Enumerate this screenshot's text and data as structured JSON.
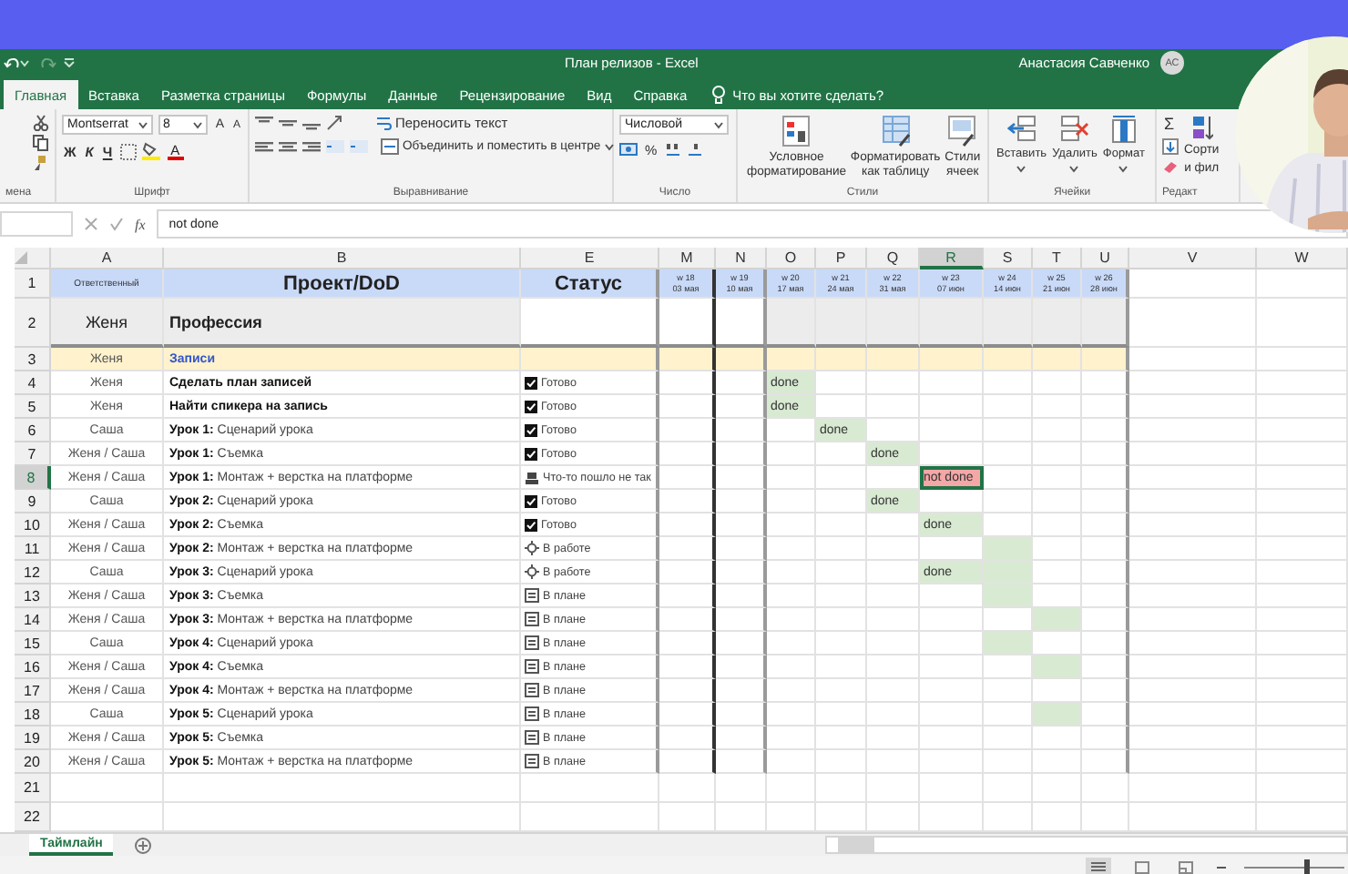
{
  "window": {
    "title": "План релизов - Excel",
    "user": "Анастасия Савченко",
    "avatar": "АС"
  },
  "ribbon_tabs": [
    {
      "label": "Главная",
      "selected": true
    },
    {
      "label": "Вставка",
      "selected": false
    },
    {
      "label": "Разметка страницы",
      "selected": false
    },
    {
      "label": "Формулы",
      "selected": false
    },
    {
      "label": "Данные",
      "selected": false
    },
    {
      "label": "Рецензирование",
      "selected": false
    },
    {
      "label": "Вид",
      "selected": false
    },
    {
      "label": "Справка",
      "selected": false
    }
  ],
  "tell_me": "Что вы хотите сделать?",
  "ribbon": {
    "clipboard": {
      "label": "мена"
    },
    "font": {
      "name": "Montserrat",
      "size": "8",
      "grow": "A",
      "shrink": "A",
      "bold": "Ж",
      "italic": "К",
      "underline": "Ч",
      "font_color_button": "A",
      "label": "Шрифт"
    },
    "alignment": {
      "wrap": "Переносить текст",
      "merge": "Объединить и поместить в центре",
      "label": "Выравнивание"
    },
    "number": {
      "format": "Числовой",
      "percent": "%",
      "label": "Число"
    },
    "styles": {
      "buttons": [
        "Условное форматирование",
        "Форматировать как таблицу",
        "Стили ячеек"
      ],
      "label": "Стили"
    },
    "cells": {
      "buttons": [
        "Вставить",
        "Удалить",
        "Формат"
      ],
      "label": "Ячейки"
    },
    "editing": {
      "sum": "Σ",
      "sort": "Сорти",
      "filter": "и фил",
      "label": "Редакт"
    }
  },
  "formula_bar": {
    "function_label": "fx",
    "value": "not done"
  },
  "sheet": {
    "columns": [
      {
        "letter": "A"
      },
      {
        "letter": "B"
      },
      {
        "letter": "E"
      },
      {
        "letter": "M"
      },
      {
        "letter": "N"
      },
      {
        "letter": "O"
      },
      {
        "letter": "P"
      },
      {
        "letter": "Q"
      },
      {
        "letter": "R"
      },
      {
        "letter": "S"
      },
      {
        "letter": "T"
      },
      {
        "letter": "U"
      },
      {
        "letter": "V"
      },
      {
        "letter": "W"
      }
    ],
    "header": {
      "number": "1",
      "responsible": "Ответственный",
      "project": "Проект/DoD",
      "status": "Статус",
      "weeks": [
        {
          "week": "w 18",
          "date": "03 мая"
        },
        {
          "week": "w 19",
          "date": "10 мая"
        },
        {
          "week": "w 20",
          "date": "17 мая"
        },
        {
          "week": "w 21",
          "date": "24 мая"
        },
        {
          "week": "w 22",
          "date": "31 мая"
        },
        {
          "week": "w 23",
          "date": "07 июн"
        },
        {
          "week": "w 24",
          "date": "14 июн"
        },
        {
          "week": "w 25",
          "date": "21 июн"
        },
        {
          "week": "w 26",
          "date": "28 июн"
        }
      ]
    },
    "subheader": {
      "number": "2",
      "responsible": "Женя",
      "project": "Профессия"
    },
    "rows": [
      {
        "number": "3",
        "kind": "section",
        "responsible": "Женя",
        "task": "Записи"
      },
      {
        "number": "4",
        "kind": "milestone",
        "responsible": "Женя",
        "task": "Сделать план записей",
        "status": {
          "kind": "done",
          "text": "Готово"
        },
        "weeks": [
          {
            "selected": false
          },
          {
            "selected": false
          },
          {
            "color": "#d9ead3",
            "text": "done",
            "selected": false
          },
          {
            "selected": false
          },
          {
            "selected": false
          },
          {
            "selected": false
          },
          {
            "selected": false
          },
          {
            "selected": false
          },
          {
            "selected": false
          }
        ]
      },
      {
        "number": "5",
        "kind": "milestone",
        "responsible": "Женя",
        "task": "Найти спикера на запись",
        "status": {
          "kind": "done",
          "text": "Готово"
        },
        "weeks": [
          {
            "selected": false
          },
          {
            "selected": false
          },
          {
            "color": "#d9ead3",
            "text": "done",
            "selected": false
          },
          {
            "selected": false
          },
          {
            "selected": false
          },
          {
            "selected": false
          },
          {
            "selected": false
          },
          {
            "selected": false
          },
          {
            "selected": false
          }
        ]
      },
      {
        "number": "6",
        "kind": "lesson",
        "responsible": "Саша",
        "task": "**Урок 1:** Сценарий урока",
        "status": {
          "kind": "done",
          "text": "Готово"
        },
        "weeks": [
          {
            "selected": false
          },
          {
            "selected": false
          },
          {
            "selected": false
          },
          {
            "color": "#d9ead3",
            "text": "done",
            "selected": false
          },
          {
            "selected": false
          },
          {
            "selected": false
          },
          {
            "selected": false
          },
          {
            "selected": false
          },
          {
            "selected": false
          }
        ]
      },
      {
        "number": "7",
        "kind": "lesson",
        "responsible": "Женя / Саша",
        "task": "**Урок 1:** Съемка",
        "status": {
          "kind": "done",
          "text": "Готово"
        },
        "weeks": [
          {
            "selected": false
          },
          {
            "selected": false
          },
          {
            "selected": false
          },
          {
            "selected": false
          },
          {
            "color": "#d9ead3",
            "text": "done",
            "selected": false
          },
          {
            "selected": false
          },
          {
            "selected": false
          },
          {
            "selected": false
          },
          {
            "selected": false
          }
        ]
      },
      {
        "number": "8",
        "kind": "lesson",
        "responsible": "Женя / Саша",
        "task": "**Урок 1:** Монтаж + верстка на платформе",
        "status": {
          "kind": "problem",
          "text": "Что-то пошло не так"
        },
        "weeks": [
          {
            "selected": false
          },
          {
            "selected": false
          },
          {
            "selected": false
          },
          {
            "selected": false
          },
          {
            "selected": false
          },
          {
            "color": "#f4a7a7",
            "text": "not done",
            "selected": true
          },
          {
            "selected": false
          },
          {
            "selected": false
          },
          {
            "selected": false
          }
        ]
      },
      {
        "number": "9",
        "kind": "lesson",
        "responsible": "Саша",
        "task": "**Урок 2:** Сценарий урока",
        "status": {
          "kind": "done",
          "text": "Готово"
        },
        "weeks": [
          {
            "selected": false
          },
          {
            "selected": false
          },
          {
            "selected": false
          },
          {
            "selected": false
          },
          {
            "color": "#d9ead3",
            "text": "done",
            "selected": false
          },
          {
            "selected": false
          },
          {
            "selected": false
          },
          {
            "selected": false
          },
          {
            "selected": false
          }
        ]
      },
      {
        "number": "10",
        "kind": "lesson",
        "responsible": "Женя / Саша",
        "task": "**Урок 2:** Съемка",
        "status": {
          "kind": "done",
          "text": "Готово"
        },
        "weeks": [
          {
            "selected": false
          },
          {
            "selected": false
          },
          {
            "selected": false
          },
          {
            "selected": false
          },
          {
            "selected": false
          },
          {
            "color": "#d9ead3",
            "text": "done",
            "selected": false
          },
          {
            "selected": false
          },
          {
            "selected": false
          },
          {
            "selected": false
          }
        ]
      },
      {
        "number": "11",
        "kind": "lesson",
        "responsible": "Женя / Саша",
        "task": "**Урок 2:** Монтаж + верстка на платформе",
        "status": {
          "kind": "in_progress",
          "text": "В работе"
        },
        "weeks": [
          {
            "selected": false
          },
          {
            "selected": false
          },
          {
            "selected": false
          },
          {
            "selected": false
          },
          {
            "selected": false
          },
          {
            "selected": false
          },
          {
            "color": "#d9ead3",
            "selected": false
          },
          {
            "selected": false
          },
          {
            "selected": false
          }
        ]
      },
      {
        "number": "12",
        "kind": "lesson",
        "responsible": "Саша",
        "task": "**Урок 3:** Сценарий урока",
        "status": {
          "kind": "in_progress",
          "text": "В работе"
        },
        "weeks": [
          {
            "selected": false
          },
          {
            "selected": false
          },
          {
            "selected": false
          },
          {
            "selected": false
          },
          {
            "selected": false
          },
          {
            "color": "#d9ead3",
            "text": "done",
            "selected": false
          },
          {
            "color": "#d9ead3",
            "selected": false
          },
          {
            "selected": false
          },
          {
            "selected": false
          }
        ]
      },
      {
        "number": "13",
        "kind": "lesson",
        "responsible": "Женя / Саша",
        "task": "**Урок 3:** Съемка",
        "status": {
          "kind": "planned",
          "text": "В плане"
        },
        "weeks": [
          {
            "selected": false
          },
          {
            "selected": false
          },
          {
            "selected": false
          },
          {
            "selected": false
          },
          {
            "selected": false
          },
          {
            "selected": false
          },
          {
            "color": "#d9ead3",
            "selected": false
          },
          {
            "selected": false
          },
          {
            "selected": false
          }
        ]
      },
      {
        "number": "14",
        "kind": "lesson",
        "responsible": "Женя / Саша",
        "task": "**Урок 3:** Монтаж + верстка на платформе",
        "status": {
          "kind": "planned",
          "text": "В плане"
        },
        "weeks": [
          {
            "selected": false
          },
          {
            "selected": false
          },
          {
            "selected": false
          },
          {
            "selected": false
          },
          {
            "selected": false
          },
          {
            "selected": false
          },
          {
            "selected": false
          },
          {
            "color": "#d9ead3",
            "selected": false
          },
          {
            "selected": false
          }
        ]
      },
      {
        "number": "15",
        "kind": "lesson",
        "responsible": "Саша",
        "task": "**Урок 4:** Сценарий урока",
        "status": {
          "kind": "planned",
          "text": "В плане"
        },
        "weeks": [
          {
            "selected": false
          },
          {
            "selected": false
          },
          {
            "selected": false
          },
          {
            "selected": false
          },
          {
            "selected": false
          },
          {
            "selected": false
          },
          {
            "color": "#d9ead3",
            "selected": false
          },
          {
            "selected": false
          },
          {
            "selected": false
          }
        ]
      },
      {
        "number": "16",
        "kind": "lesson",
        "responsible": "Женя / Саша",
        "task": "**Урок 4:** Съемка",
        "status": {
          "kind": "planned",
          "text": "В плане"
        },
        "weeks": [
          {
            "selected": false
          },
          {
            "selected": false
          },
          {
            "selected": false
          },
          {
            "selected": false
          },
          {
            "selected": false
          },
          {
            "selected": false
          },
          {
            "selected": false
          },
          {
            "color": "#d9ead3",
            "selected": false
          },
          {
            "selected": false
          }
        ]
      },
      {
        "number": "17",
        "kind": "lesson",
        "responsible": "Женя / Саша",
        "task": "**Урок 4:** Монтаж + верстка на платформе",
        "status": {
          "kind": "planned",
          "text": "В плане"
        },
        "weeks": [
          {
            "selected": false
          },
          {
            "selected": false
          },
          {
            "selected": false
          },
          {
            "selected": false
          },
          {
            "selected": false
          },
          {
            "selected": false
          },
          {
            "selected": false
          },
          {
            "selected": false
          },
          {
            "selected": false
          }
        ]
      },
      {
        "number": "18",
        "kind": "lesson",
        "responsible": "Саша",
        "task": "**Урок 5:** Сценарий урока",
        "status": {
          "kind": "planned",
          "text": "В плане"
        },
        "weeks": [
          {
            "selected": false
          },
          {
            "selected": false
          },
          {
            "selected": false
          },
          {
            "selected": false
          },
          {
            "selected": false
          },
          {
            "selected": false
          },
          {
            "selected": false
          },
          {
            "color": "#d9ead3",
            "selected": false
          },
          {
            "selected": false
          }
        ]
      },
      {
        "number": "19",
        "kind": "lesson",
        "responsible": "Женя / Саша",
        "task": "**Урок 5:** Съемка",
        "status": {
          "kind": "planned",
          "text": "В плане"
        },
        "weeks": [
          {
            "selected": false
          },
          {
            "selected": false
          },
          {
            "selected": false
          },
          {
            "selected": false
          },
          {
            "selected": false
          },
          {
            "selected": false
          },
          {
            "selected": false
          },
          {
            "selected": false
          },
          {
            "selected": false
          }
        ]
      },
      {
        "number": "20",
        "kind": "lesson",
        "responsible": "Женя / Саша",
        "task": "**Урок 5:** Монтаж + верстка на платформе",
        "status": {
          "kind": "planned",
          "text": "В плане"
        },
        "weeks": [
          {
            "selected": false
          },
          {
            "selected": false
          },
          {
            "selected": false
          },
          {
            "selected": false
          },
          {
            "selected": false
          },
          {
            "selected": false
          },
          {
            "selected": false
          },
          {
            "selected": false
          },
          {
            "selected": false
          }
        ]
      },
      {
        "number": "21",
        "kind": "empty"
      },
      {
        "number": "22",
        "kind": "empty"
      }
    ]
  },
  "sheet_tabs": [
    {
      "label": "Таймлайн",
      "selected": true
    }
  ],
  "status_bar": {
    "zoom": {
      "level": 0.6
    }
  }
}
